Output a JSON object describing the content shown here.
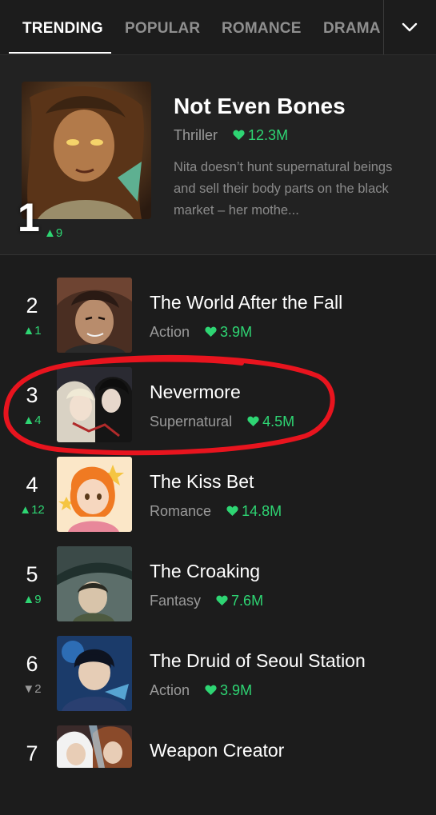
{
  "tabs": [
    {
      "label": "TRENDING",
      "active": true
    },
    {
      "label": "POPULAR",
      "active": false
    },
    {
      "label": "ROMANCE",
      "active": false
    },
    {
      "label": "DRAMA",
      "active": false
    }
  ],
  "dropdown_icon": "chevron-down-icon",
  "featured": {
    "rank": "1",
    "change": "▲9",
    "title": "Not Even Bones",
    "genre": "Thriller",
    "likes": "12.3M",
    "description": "Nita doesn’t hunt supernatural beings and sell their body parts on the black market – her mothe..."
  },
  "list": [
    {
      "rank": "2",
      "change": "▲1",
      "direction": "up",
      "title": "The World After the Fall",
      "genre": "Action",
      "likes": "3.9M"
    },
    {
      "rank": "3",
      "change": "▲4",
      "direction": "up",
      "title": "Nevermore",
      "genre": "Supernatural",
      "likes": "4.5M"
    },
    {
      "rank": "4",
      "change": "▲12",
      "direction": "up",
      "title": "The Kiss Bet",
      "genre": "Romance",
      "likes": "14.8M"
    },
    {
      "rank": "5",
      "change": "▲9",
      "direction": "up",
      "title": "The Croaking",
      "genre": "Fantasy",
      "likes": "7.6M"
    },
    {
      "rank": "6",
      "change": "▼2",
      "direction": "down",
      "title": "The Druid of Seoul Station",
      "genre": "Action",
      "likes": "3.9M"
    },
    {
      "rank": "7",
      "change": "",
      "direction": "",
      "title": "Weapon Creator",
      "genre": "",
      "likes": ""
    }
  ],
  "colors": {
    "accent_green": "#2ed573",
    "highlight_red": "#e8141e",
    "background": "#1c1c1c"
  }
}
